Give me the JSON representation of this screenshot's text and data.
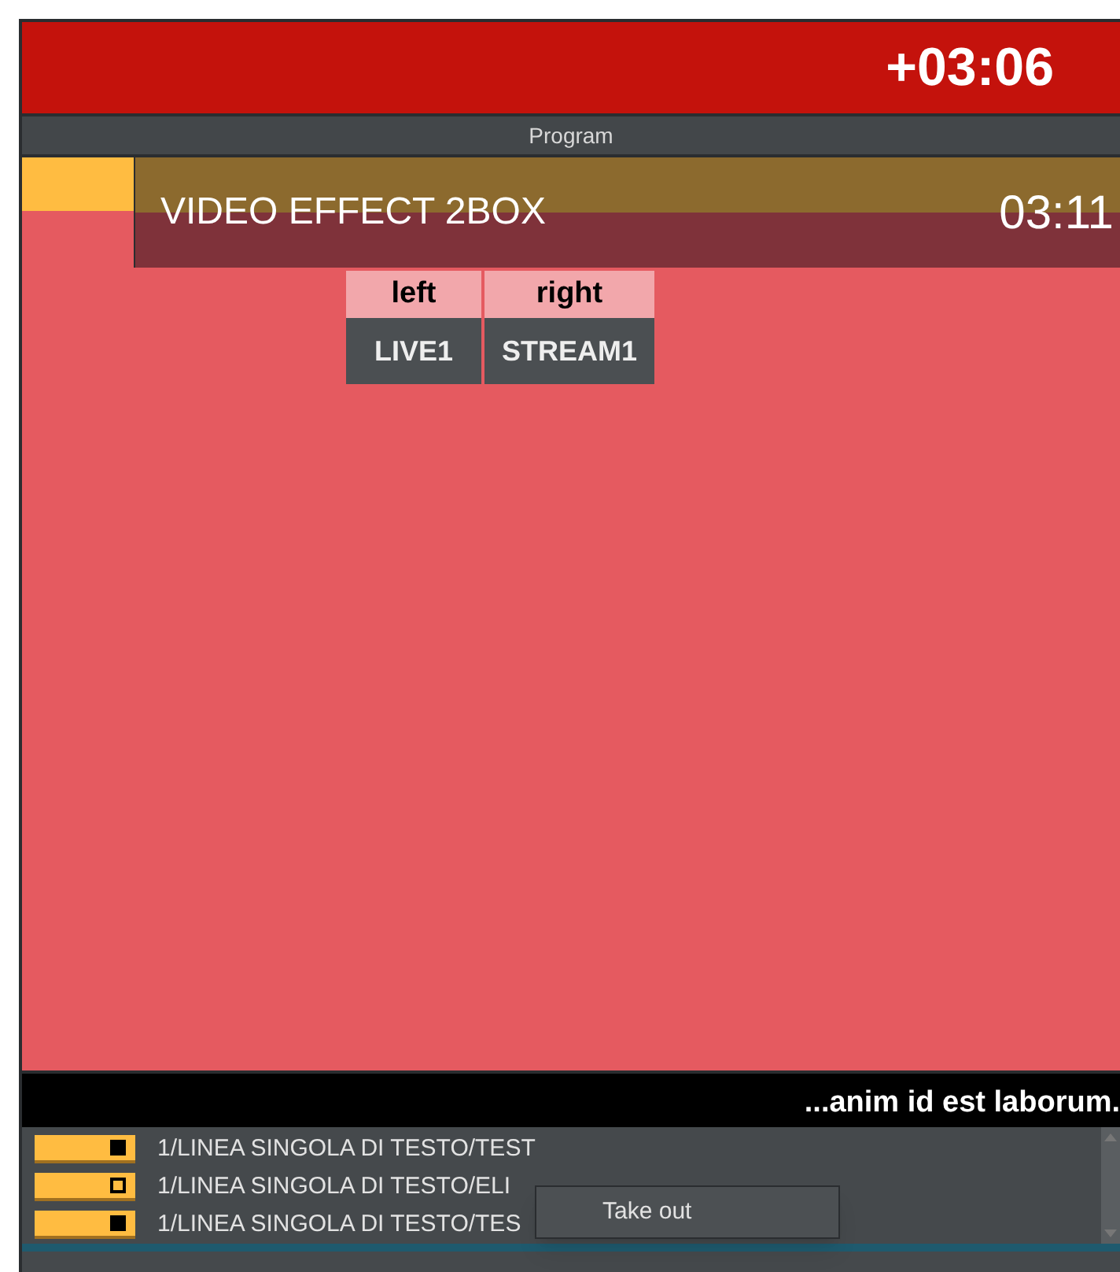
{
  "header": {
    "countdown": "+03:06"
  },
  "program_bar": {
    "title": "Program"
  },
  "current_item": {
    "title": "VIDEO EFFECT 2BOX",
    "duration": "03:11"
  },
  "sources": {
    "columns": [
      "left",
      "right"
    ],
    "values": [
      "LIVE1",
      "STREAM1"
    ]
  },
  "ticker": {
    "text": "...anim id est laborum."
  },
  "playlist": [
    {
      "label": "1/LINEA SINGOLA DI TESTO/TEST",
      "active": true
    },
    {
      "label": "1/LINEA SINGOLA DI TESTO/ELI",
      "active": false
    },
    {
      "label": "1/LINEA SINGOLA DI TESTO/TES",
      "active": true
    }
  ],
  "context_menu": {
    "items": [
      "Take out"
    ]
  }
}
